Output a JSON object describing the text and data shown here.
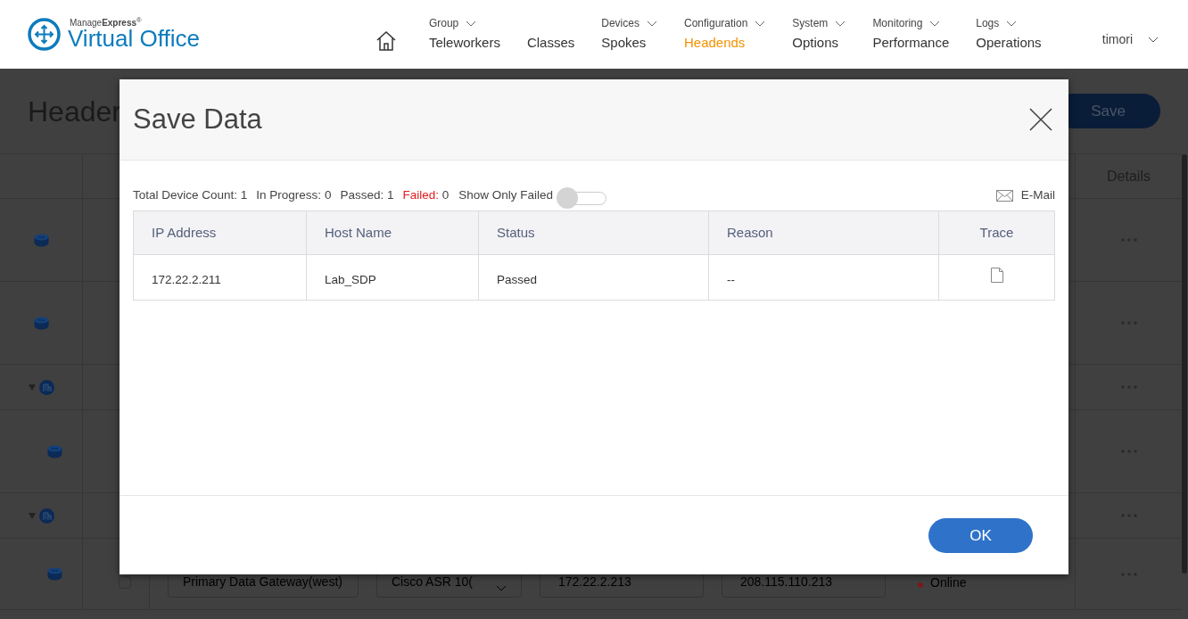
{
  "nav": {
    "brand": "Manage**Express**$^{®}$",
    "product": "Virtual Office",
    "items": [
      {
        "kind": "home",
        "selected": false
      },
      {
        "kind": "menu",
        "group": "Group",
        "label": "Teleworkers",
        "selected": false
      },
      {
        "kind": "link",
        "label": "Classes",
        "selected": false
      },
      {
        "kind": "menu",
        "group": "Devices",
        "label": "Spokes",
        "selected": false
      },
      {
        "kind": "menu",
        "group": "Configuration",
        "label": "Headends",
        "selected": true
      },
      {
        "kind": "menu",
        "group": "System",
        "label": "Options",
        "selected": false
      },
      {
        "kind": "menu",
        "group": "Monitoring",
        "label": "Performance",
        "selected": false
      },
      {
        "kind": "menu",
        "group": "Logs",
        "label": "Operations",
        "selected": false
      }
    ],
    "user": "timori"
  },
  "page": {
    "title": "Header",
    "save_button": "Save",
    "details_column": "Details",
    "rows": [
      {
        "kind": "device"
      },
      {
        "kind": "device"
      },
      {
        "kind": "group",
        "expanded": true,
        "children": [
          {
            "kind": "device"
          }
        ]
      },
      {
        "kind": "group",
        "expanded": true,
        "children": [
          {
            "kind": "device",
            "checked": false,
            "name": "Primary Data Gateway(west)",
            "model": "Cisco ASR 10(",
            "ip": "172.22.2.213",
            "public_ip": "208.115.110.213",
            "status": "Online",
            "color": "#7a1a1a"
          }
        ]
      }
    ]
  },
  "modal": {
    "title": "Save Data",
    "stats": [
      {
        "label": "Total Device Count:",
        "value": "1",
        "alert": false
      },
      {
        "label": "In Progress:",
        "value": "0",
        "alert": false
      },
      {
        "label": "Passed:",
        "value": "1",
        "alert": false
      },
      {
        "label": "Failed:",
        "value": "0",
        "alert": true
      }
    ],
    "toggle": {
      "label": "Show Only Failed",
      "on": false
    },
    "email": "E-Mail",
    "columns": [
      "IP Address",
      "Host Name",
      "Status",
      "Reason",
      "Trace"
    ],
    "rows": [
      {
        "ip": "172.22.2.211",
        "host": "Lab_SDP",
        "status": "Passed",
        "reason": "--"
      }
    ],
    "ok": "OK"
  }
}
